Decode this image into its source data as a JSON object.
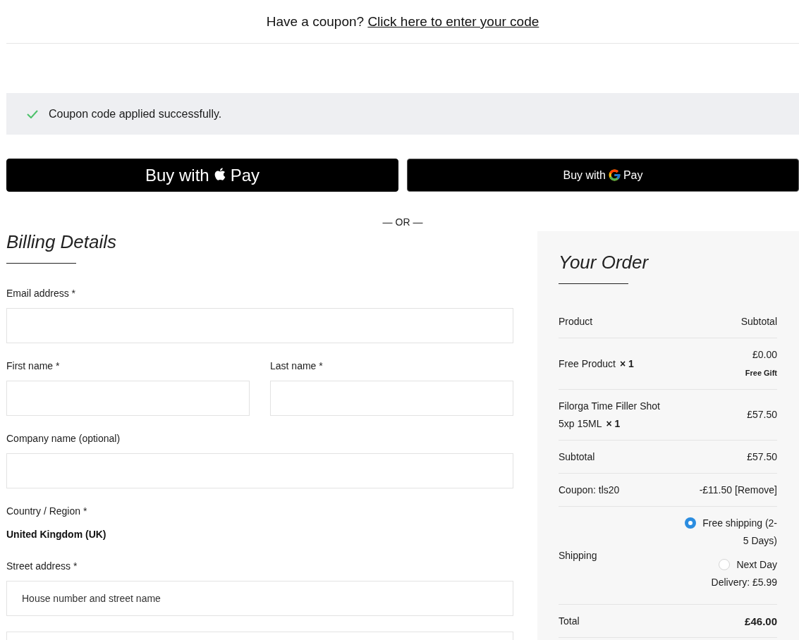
{
  "coupon_prompt": {
    "text": "Have a coupon?",
    "link": "Click here to enter your code"
  },
  "notice": {
    "message": "Coupon code applied successfully."
  },
  "express_buttons": [
    {
      "kind": "apple",
      "label": "Buy with",
      "brand": "Pay"
    },
    {
      "kind": "google",
      "label": "Buy with",
      "brand": "Pay"
    }
  ],
  "separator": "— OR —",
  "billing": {
    "title": "Billing Details",
    "fields": [
      {
        "kind": "input",
        "label": "Email address *"
      },
      {
        "kind": "pair",
        "fields": [
          {
            "label": "First name *"
          },
          {
            "label": "Last name *"
          }
        ]
      },
      {
        "kind": "input",
        "label": "Company name (optional)"
      },
      {
        "kind": "static",
        "label": "Country / Region *",
        "value": "United Kingdom (UK)"
      },
      {
        "kind": "input",
        "label": "Street address *",
        "placeholder": "House number and street name"
      },
      {
        "kind": "input"
      }
    ]
  },
  "order": {
    "title": "Your Order",
    "columns": [
      "Product",
      "Subtotal"
    ],
    "items": [
      {
        "name": "Free Product",
        "quantity": "× 1",
        "price": "£0.00",
        "note": "Free Gift"
      },
      {
        "name": "Filorga Time Filler Shot 5xp 15ML",
        "quantity": "× 1",
        "price": "£57.50"
      }
    ],
    "subtotal": {
      "label": "Subtotal",
      "value": "£57.50"
    },
    "coupon": {
      "label": "Coupon: tls20",
      "amount": "-£11.50",
      "action": "[Remove]"
    },
    "shipping": {
      "label": "Shipping",
      "options": [
        {
          "label": "Free shipping (2-5 Days)",
          "selected": true
        },
        {
          "label": "Next Day Delivery: £5.99",
          "selected": false
        }
      ]
    },
    "total": {
      "label": "Total",
      "value": "£46.00"
    }
  }
}
